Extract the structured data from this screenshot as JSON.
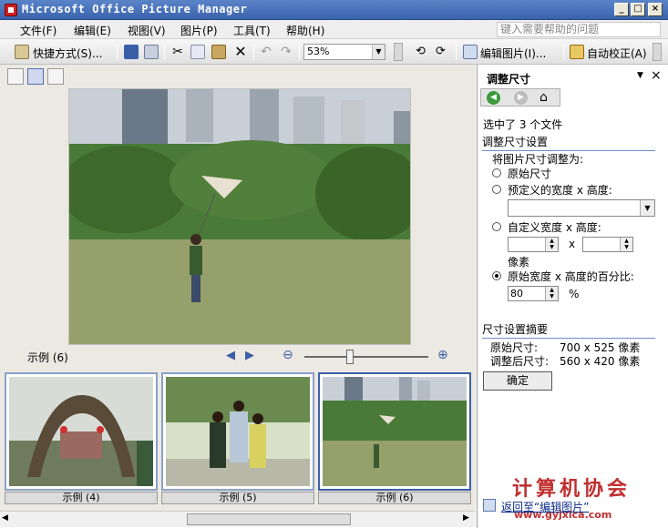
{
  "window": {
    "title": "Microsoft Office Picture Manager"
  },
  "menu": {
    "items": [
      "文件(F)",
      "编辑(E)",
      "视图(V)",
      "图片(P)",
      "工具(T)",
      "帮助(H)"
    ],
    "help_placeholder": "键入需要帮助的问题"
  },
  "toolbar": {
    "shortcuts_label": "快捷方式(S)...",
    "zoom_value": "53%",
    "edit_pictures_label": "编辑图片(I)...",
    "auto_correct_label": "自动校正(A)"
  },
  "main": {
    "group_label": "示例 (6)",
    "thumbnails": [
      {
        "label": "示例 (4)"
      },
      {
        "label": "示例 (5)"
      },
      {
        "label": "示例 (6)"
      }
    ],
    "preview_watermark": "计算机协会 www.gyjxica.com"
  },
  "pane": {
    "title": "调整尺寸",
    "selection_info": "选中了 3 个文件",
    "settings_title": "调整尺寸设置",
    "resize_to_label": "将图片尺寸调整为:",
    "options": {
      "original": "原始尺寸",
      "predefined": "预定义的宽度 x 高度:",
      "custom": "自定义宽度 x 高度:",
      "percent": "原始宽度 x 高度的百分比:"
    },
    "custom_times": "x",
    "custom_unit": "像素",
    "percent_value": "80",
    "percent_unit": "%",
    "summary_title": "尺寸设置摘要",
    "original_size_label": "原始尺寸:",
    "original_size_value": "700 x 525 像素",
    "new_size_label": "调整后尺寸:",
    "new_size_value": "560 x 420 像素",
    "ok_label": "确定",
    "back_link": "返回至“编辑图片”",
    "watermark": "计算机协会",
    "watermark_url": "www.gyjxica.com"
  },
  "colors": {
    "title_bar": "#3a63ad",
    "selection_border": "#3a5fa8",
    "accent_underline": "#6f8fc5"
  }
}
